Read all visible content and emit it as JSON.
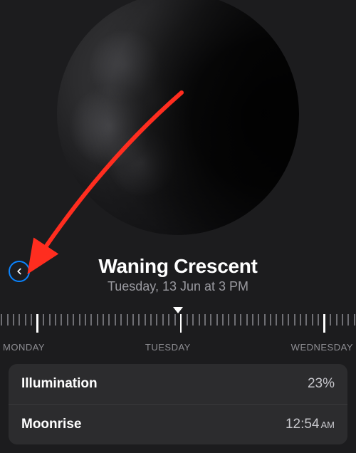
{
  "moon": {
    "phase_title": "Waning Crescent",
    "subtitle": "Tuesday, 13 Jun at 3 PM"
  },
  "ruler": {
    "labels": [
      "MONDAY",
      "TUESDAY",
      "WEDNESDAY"
    ]
  },
  "stats": {
    "illumination": {
      "label": "Illumination",
      "value": "23%"
    },
    "moonrise": {
      "label": "Moonrise",
      "time": "12:54",
      "ampm": "AM"
    }
  },
  "annotation": {
    "arrow_color": "#ff2d1f",
    "highlight_color": "#0a84ff"
  }
}
